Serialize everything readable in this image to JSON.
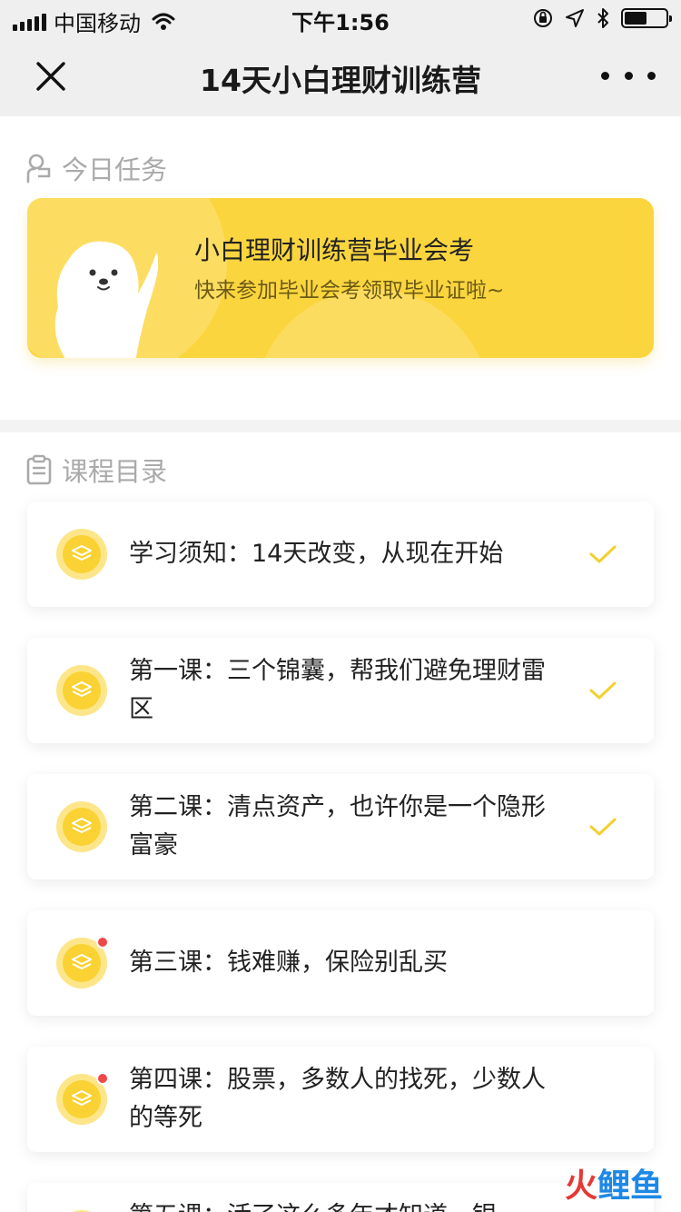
{
  "status_bar": {
    "carrier": "中国移动",
    "time": "下午1:56",
    "battery_level": 0.55
  },
  "nav": {
    "title": "14天小白理财训练营"
  },
  "today_task": {
    "section_label": "今日任务",
    "banner_title": "小白理财训练营毕业会考",
    "banner_subtitle": "快来参加毕业会考领取毕业证啦~"
  },
  "course_list": {
    "section_label": "课程目录",
    "lessons": [
      {
        "title": "学习须知：14天改变，从现在开始",
        "completed": true,
        "new": false
      },
      {
        "title": "第一课：三个锦囊，帮我们避免理财雷区",
        "completed": true,
        "new": false
      },
      {
        "title": "第二课：清点资产，也许你是一个隐形富豪",
        "completed": true,
        "new": false
      },
      {
        "title": "第三课：钱难赚，保险别乱买",
        "completed": false,
        "new": true
      },
      {
        "title": "第四课：股票，多数人的找死，少数人的等死",
        "completed": false,
        "new": true
      },
      {
        "title": "第五课：活了这么多年才知道，银",
        "completed": false,
        "new": false
      }
    ]
  },
  "watermark": {
    "part1": "火",
    "part2": "鲤鱼"
  },
  "colors": {
    "accent_yellow": "#fad234",
    "banner_yellow": "#fbd53e",
    "new_dot_red": "#f04848"
  }
}
